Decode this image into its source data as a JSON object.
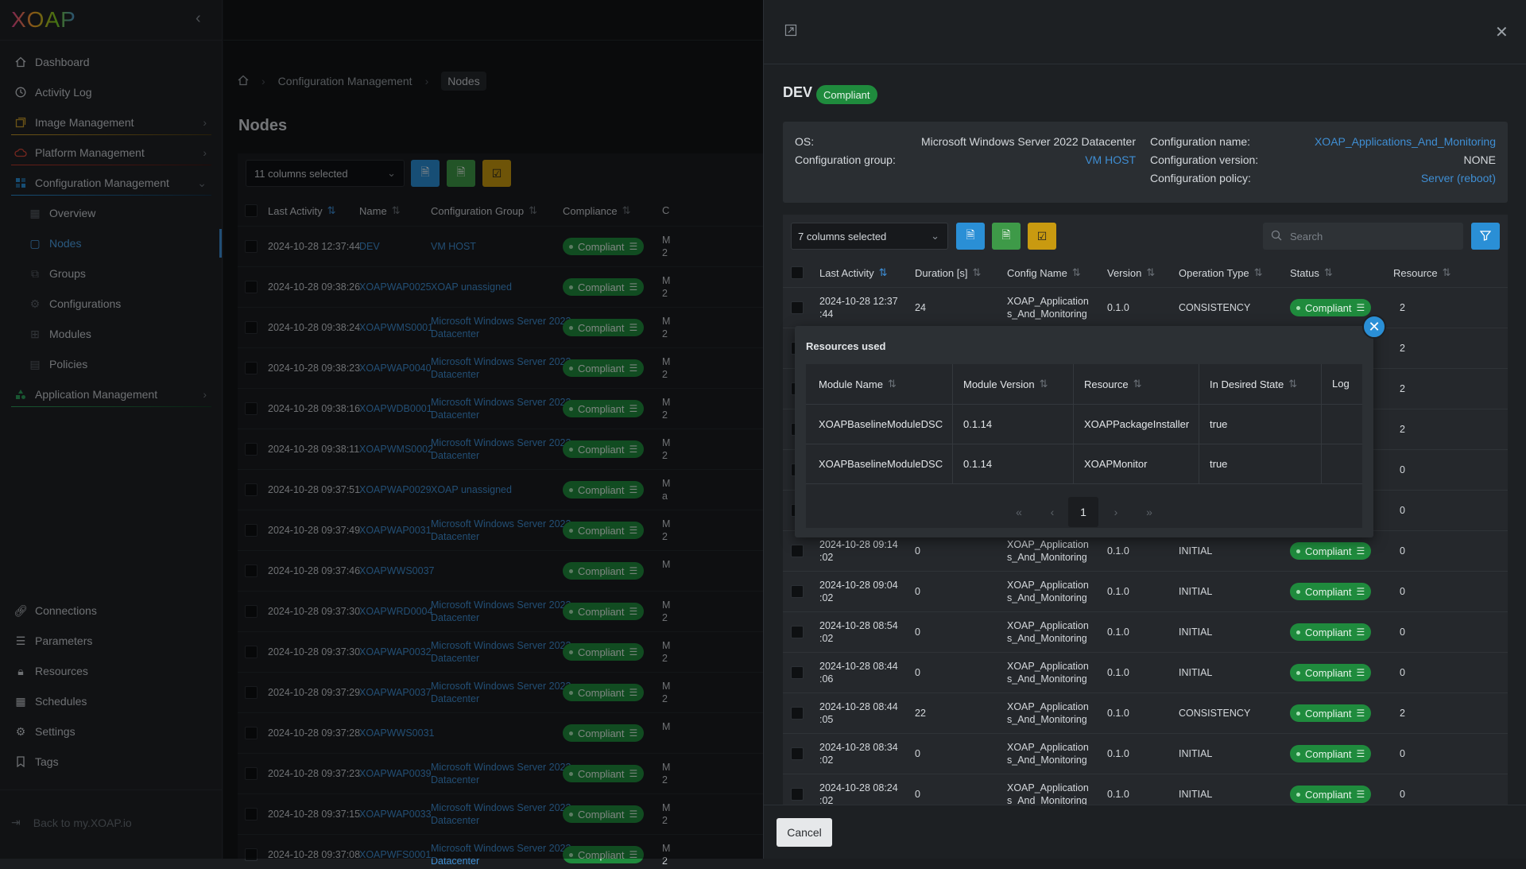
{
  "app": {
    "logo_text": "XOAP"
  },
  "sidebar": {
    "items": [
      {
        "label": "Dashboard",
        "icon": "home-icon"
      },
      {
        "label": "Activity Log",
        "icon": "clock-icon"
      },
      {
        "label": "Image Management",
        "icon": "image-icon"
      },
      {
        "label": "Platform Management",
        "icon": "cloud-icon"
      },
      {
        "label": "Configuration Management",
        "icon": "config-icon"
      },
      {
        "label": "Application Management",
        "icon": "apps-icon"
      }
    ],
    "config_sub": [
      {
        "label": "Overview"
      },
      {
        "label": "Nodes"
      },
      {
        "label": "Groups"
      },
      {
        "label": "Configurations"
      },
      {
        "label": "Modules"
      },
      {
        "label": "Policies"
      }
    ],
    "bottom": [
      {
        "label": "Connections"
      },
      {
        "label": "Parameters"
      },
      {
        "label": "Resources"
      },
      {
        "label": "Schedules"
      },
      {
        "label": "Settings"
      },
      {
        "label": "Tags"
      }
    ],
    "back_label": "Back to my.XOAP.io",
    "accent_colors": {
      "image": "#c79a2a",
      "platform": "#c0392b",
      "config": "#2a8fd6",
      "application": "#2e9e5b"
    }
  },
  "breadcrumb": {
    "items": [
      "Configuration Management",
      "Nodes"
    ]
  },
  "page_title": "Nodes",
  "nodes_table": {
    "columns_selected": "11 columns selected",
    "headers": [
      "Last Activity",
      "Name",
      "Configuration Group",
      "Compliance",
      "C"
    ],
    "rows": [
      {
        "last": "2024-10-28 12:37:44",
        "name": "DEV",
        "group": [
          "VM HOST"
        ],
        "compliance": "Compliant",
        "extra": [
          "M",
          "2"
        ]
      },
      {
        "last": "2024-10-28 09:38:26",
        "name": "XOAPWAP0025",
        "group": [
          "XOAP unassigned"
        ],
        "compliance": "Compliant",
        "extra": [
          "M",
          "2"
        ]
      },
      {
        "last": "2024-10-28 09:38:24",
        "name": "XOAPWMS0001",
        "group": [
          "Microsoft Windows Server 2022",
          "Datacenter"
        ],
        "compliance": "Compliant",
        "extra": [
          "M",
          "2"
        ]
      },
      {
        "last": "2024-10-28 09:38:23",
        "name": "XOAPWAP0040",
        "group": [
          "Microsoft Windows Server 2022",
          "Datacenter"
        ],
        "compliance": "Compliant",
        "extra": [
          "M",
          "2"
        ]
      },
      {
        "last": "2024-10-28 09:38:16",
        "name": "XOAPWDB0001",
        "group": [
          "Microsoft Windows Server 2022",
          "Datacenter"
        ],
        "compliance": "Compliant",
        "extra": [
          "M",
          "2"
        ]
      },
      {
        "last": "2024-10-28 09:38:11",
        "name": "XOAPWMS0002",
        "group": [
          "Microsoft Windows Server 2022",
          "Datacenter"
        ],
        "compliance": "Compliant",
        "extra": [
          "M",
          "2"
        ]
      },
      {
        "last": "2024-10-28 09:37:51",
        "name": "XOAPWAP0029",
        "group": [
          "XOAP unassigned"
        ],
        "compliance": "Compliant",
        "extra": [
          "M",
          "a"
        ]
      },
      {
        "last": "2024-10-28 09:37:49",
        "name": "XOAPWAP0031",
        "group": [
          "Microsoft Windows Server 2022",
          "Datacenter"
        ],
        "compliance": "Compliant",
        "extra": [
          "M",
          "2"
        ]
      },
      {
        "last": "2024-10-28 09:37:46",
        "name": "XOAPWWS0037",
        "group": [],
        "compliance": "Compliant",
        "extra": [
          "M",
          ""
        ]
      },
      {
        "last": "2024-10-28 09:37:30",
        "name": "XOAPWRD0004",
        "group": [
          "Microsoft Windows Server 2022",
          "Datacenter"
        ],
        "compliance": "Compliant",
        "extra": [
          "M",
          "2"
        ]
      },
      {
        "last": "2024-10-28 09:37:30",
        "name": "XOAPWAP0032",
        "group": [
          "Microsoft Windows Server 2022",
          "Datacenter"
        ],
        "compliance": "Compliant",
        "extra": [
          "M",
          "2"
        ]
      },
      {
        "last": "2024-10-28 09:37:29",
        "name": "XOAPWAP0037",
        "group": [
          "Microsoft Windows Server 2022",
          "Datacenter"
        ],
        "compliance": "Compliant",
        "extra": [
          "M",
          "2"
        ]
      },
      {
        "last": "2024-10-28 09:37:28",
        "name": "XOAPWWS0031",
        "group": [],
        "compliance": "Compliant",
        "extra": [
          "M",
          ""
        ]
      },
      {
        "last": "2024-10-28 09:37:23",
        "name": "XOAPWAP0039",
        "group": [
          "Microsoft Windows Server 2022",
          "Datacenter"
        ],
        "compliance": "Compliant",
        "extra": [
          "M",
          "2"
        ]
      },
      {
        "last": "2024-10-28 09:37:15",
        "name": "XOAPWAP0033",
        "group": [
          "Microsoft Windows Server 2022",
          "Datacenter"
        ],
        "compliance": "Compliant",
        "extra": [
          "M",
          "2"
        ]
      },
      {
        "last": "2024-10-28 09:37:08",
        "name": "XOAPWFS0001",
        "group": [
          "Microsoft Windows Server 2022",
          "Datacenter"
        ],
        "compliance": "Compliant",
        "extra": [
          "M",
          "2"
        ]
      }
    ]
  },
  "detail": {
    "title": "DEV",
    "badge": "Compliant",
    "os_label": "OS:",
    "os_value": "Microsoft Windows Server 2022 Datacenter",
    "group_label": "Configuration group:",
    "group_value": "VM HOST",
    "cfg_name_label": "Configuration name:",
    "cfg_name_value": "XOAP_Applications_And_Monitoring",
    "cfg_version_label": "Configuration version:",
    "cfg_version_value": "NONE",
    "cfg_policy_label": "Configuration policy:",
    "cfg_policy_value": "Server (reboot)",
    "columns_selected": "7 columns selected",
    "search_placeholder": "Search",
    "headers": [
      "Last Activity",
      "Duration [s]",
      "Config Name",
      "Version",
      "Operation Type",
      "Status",
      "Resource"
    ],
    "rows": [
      {
        "last": [
          "2024-10-28 12:37",
          ":44"
        ],
        "duration": "24",
        "config": [
          "XOAP_Application",
          "s_And_Monitoring"
        ],
        "version": "0.1.0",
        "op": "CONSISTENCY",
        "status": "Compliant",
        "resource": "2"
      },
      {
        "last": [
          "",
          ""
        ],
        "duration": "",
        "config": [
          "",
          ""
        ],
        "version": "",
        "op": "",
        "status": "",
        "resource": "2"
      },
      {
        "last": [
          "",
          ""
        ],
        "duration": "",
        "config": [
          "",
          ""
        ],
        "version": "",
        "op": "",
        "status": "",
        "resource": "2"
      },
      {
        "last": [
          "",
          ""
        ],
        "duration": "",
        "config": [
          "",
          ""
        ],
        "version": "",
        "op": "",
        "status": "",
        "resource": "2"
      },
      {
        "last": [
          "",
          ""
        ],
        "duration": "",
        "config": [
          "",
          ""
        ],
        "version": "",
        "op": "",
        "status": "",
        "resource": "0"
      },
      {
        "last": [
          "",
          ""
        ],
        "duration": "",
        "config": [
          "",
          ""
        ],
        "version": "",
        "op": "",
        "status": "",
        "resource": "0"
      },
      {
        "last": [
          "2024-10-28 09:14",
          ":02"
        ],
        "duration": "0",
        "config": [
          "XOAP_Application",
          "s_And_Monitoring"
        ],
        "version": "0.1.0",
        "op": "INITIAL",
        "status": "Compliant",
        "resource": "0"
      },
      {
        "last": [
          "2024-10-28 09:04",
          ":02"
        ],
        "duration": "0",
        "config": [
          "XOAP_Application",
          "s_And_Monitoring"
        ],
        "version": "0.1.0",
        "op": "INITIAL",
        "status": "Compliant",
        "resource": "0"
      },
      {
        "last": [
          "2024-10-28 08:54",
          ":02"
        ],
        "duration": "0",
        "config": [
          "XOAP_Application",
          "s_And_Monitoring"
        ],
        "version": "0.1.0",
        "op": "INITIAL",
        "status": "Compliant",
        "resource": "0"
      },
      {
        "last": [
          "2024-10-28 08:44",
          ":06"
        ],
        "duration": "0",
        "config": [
          "XOAP_Application",
          "s_And_Monitoring"
        ],
        "version": "0.1.0",
        "op": "INITIAL",
        "status": "Compliant",
        "resource": "0"
      },
      {
        "last": [
          "2024-10-28 08:44",
          ":05"
        ],
        "duration": "22",
        "config": [
          "XOAP_Application",
          "s_And_Monitoring"
        ],
        "version": "0.1.0",
        "op": "CONSISTENCY",
        "status": "Compliant",
        "resource": "2"
      },
      {
        "last": [
          "2024-10-28 08:34",
          ":02"
        ],
        "duration": "0",
        "config": [
          "XOAP_Application",
          "s_And_Monitoring"
        ],
        "version": "0.1.0",
        "op": "INITIAL",
        "status": "Compliant",
        "resource": "0"
      },
      {
        "last": [
          "2024-10-28 08:24",
          ":02"
        ],
        "duration": "0",
        "config": [
          "XOAP_Application",
          "s_And_Monitoring"
        ],
        "version": "0.1.0",
        "op": "INITIAL",
        "status": "Compliant",
        "resource": "0"
      }
    ],
    "cancel_label": "Cancel"
  },
  "resources_popup": {
    "title": "Resources used",
    "headers": [
      "Module Name",
      "Module Version",
      "Resource",
      "In Desired State",
      "Log"
    ],
    "rows": [
      {
        "module": "XOAPBaselineModuleDSC",
        "version": "0.1.14",
        "resource": "XOAPPackageInstaller",
        "state": "true"
      },
      {
        "module": "XOAPBaselineModuleDSC",
        "version": "0.1.14",
        "resource": "XOAPMonitor",
        "state": "true"
      }
    ],
    "current_page": "1"
  }
}
